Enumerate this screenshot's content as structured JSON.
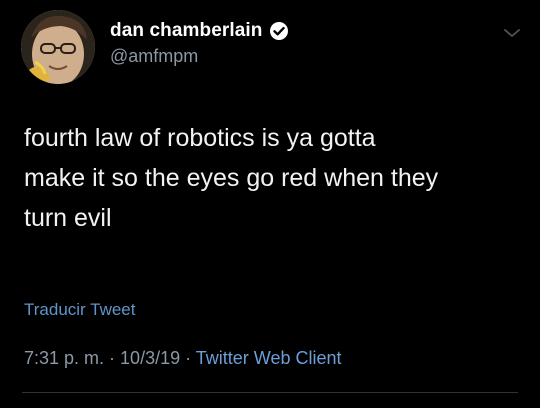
{
  "user": {
    "display_name": "dan chamberlain",
    "handle": "@amfmpm",
    "verified": true
  },
  "tweet": {
    "text": "fourth law of robotics is ya gotta\nmake it so the eyes go red when they\nturn evil",
    "translate_label": "Traducir Tweet"
  },
  "meta": {
    "time": "7:31 p. m.",
    "separator1": " · ",
    "date": "10/3/19",
    "separator2": " · ",
    "client": "Twitter Web Client"
  },
  "icons": {
    "verified": "verified-badge-icon",
    "menu": "chevron-down-icon"
  },
  "colors": {
    "background": "#000000",
    "link": "#5f95c8",
    "secondary_text": "#8b98a5"
  }
}
